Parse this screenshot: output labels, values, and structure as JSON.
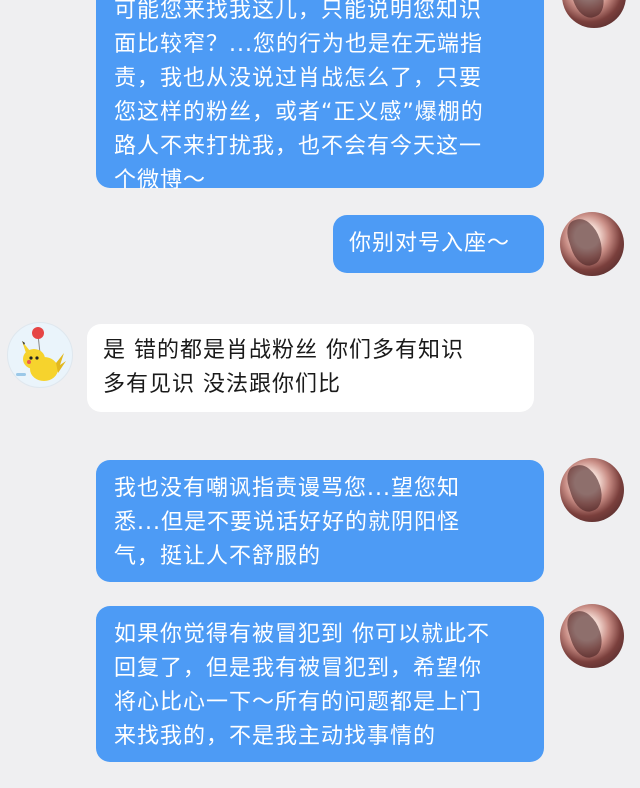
{
  "messages": [
    {
      "id": "m1",
      "side": "out",
      "lines": [
        "可能您来找我这儿，只能说明您知识",
        "面比较窄？...您的行为也是在无端指",
        "责，我也从没说过肖战怎么了，只要",
        "您这样的粉丝，或者“正义感”爆棚的",
        "路人不来打扰我，也不会有今天这一",
        "个微博～"
      ]
    },
    {
      "id": "m2",
      "side": "out",
      "lines": [
        "你别对号入座～"
      ]
    },
    {
      "id": "m3",
      "side": "in",
      "lines": [
        "是 错的都是肖战粉丝 你们多有知识",
        "多有见识 没法跟你们比"
      ]
    },
    {
      "id": "m4",
      "side": "out",
      "lines": [
        "我也没有嘲讽指责谩骂您...望您知",
        "悉...但是不要说话好好的就阴阳怪",
        "气，挺让人不舒服的"
      ]
    },
    {
      "id": "m5",
      "side": "out",
      "lines": [
        "如果你觉得有被冒犯到 你可以就此不",
        "回复了，但是我有被冒犯到，希望你",
        "将心比心一下～所有的问题都是上门",
        "来找我的，不是我主动找事情的"
      ]
    }
  ],
  "avatars": {
    "self": "user-avatar-photo",
    "peer": "pikachu-balloon-avatar"
  },
  "colors": {
    "background": "#efeff1",
    "outgoing_bubble": "#4d9bf5",
    "incoming_bubble": "#ffffff",
    "outgoing_text": "#ffffff",
    "incoming_text": "#1a1a1a"
  }
}
